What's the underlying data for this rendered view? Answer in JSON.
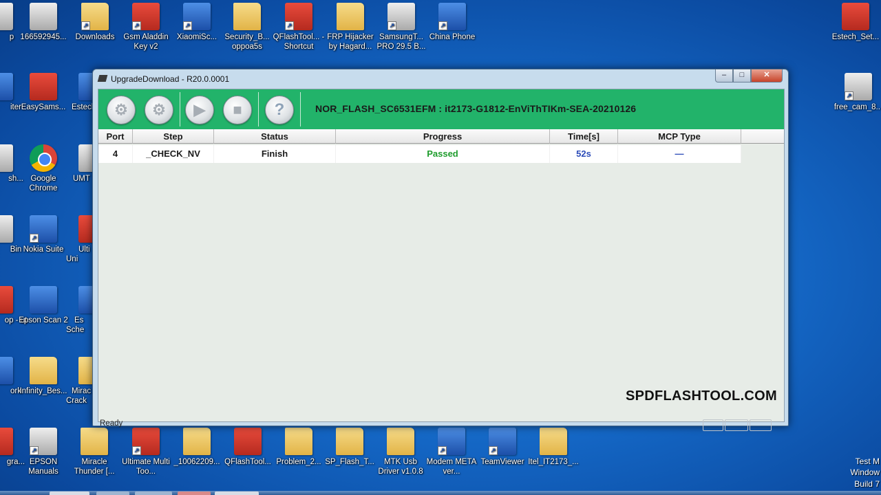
{
  "desktop": {
    "top_icons": [
      {
        "label": "p"
      },
      {
        "label": "166592945..."
      },
      {
        "label": "Downloads"
      },
      {
        "label": "Gsm Aladdin Key v2"
      },
      {
        "label": "XiaomiSc..."
      },
      {
        "label": "Security_B... oppoa5s"
      },
      {
        "label": "QFlashTool... - Shortcut"
      },
      {
        "label": "FRP Hijacker by Hagard..."
      },
      {
        "label": "SamsungT... PRO 29.5 B..."
      },
      {
        "label": "China Phone"
      },
      {
        "label": "Estech_Set..."
      }
    ],
    "left_icons": [
      {
        "label": "iter"
      },
      {
        "label": "EasySams..."
      },
      {
        "label": "Estech"
      },
      {
        "label": "sh..."
      },
      {
        "label": "Google Chrome"
      },
      {
        "label": "UMT"
      },
      {
        "label": "Bin"
      },
      {
        "label": "Nokia Suite"
      },
      {
        "label": "Ulti Uni"
      },
      {
        "label": "op - ut"
      },
      {
        "label": "Epson Scan 2"
      },
      {
        "label": "Es Sche"
      },
      {
        "label": "ork"
      },
      {
        "label": "Infinity_Bes..."
      },
      {
        "label": "Mirac Crack"
      },
      {
        "label": "gra..."
      },
      {
        "label": "EPSON Manuals"
      }
    ],
    "right_icons": [
      {
        "label": "free_cam_8..."
      }
    ],
    "bottom_icons": [
      {
        "label": "Miracle Thunder [..."
      },
      {
        "label": "Ultimate Multi Too..."
      },
      {
        "label": "_10062209..."
      },
      {
        "label": "QFlashTool..."
      },
      {
        "label": "Problem_2..."
      },
      {
        "label": "SP_Flash_T..."
      },
      {
        "label": "MTK Usb Driver v1.0.8"
      },
      {
        "label": "Modem META ver..."
      },
      {
        "label": "TeamViewer"
      },
      {
        "label": "Itel_IT2173_..."
      }
    ],
    "watermark_lines": [
      "Test M",
      "Window",
      "Build 7"
    ]
  },
  "window": {
    "title": "UpgradeDownload  -  R20.0.0001",
    "controls": {
      "minimize": "–",
      "maximize": "□",
      "close": "✕"
    },
    "toolbar": {
      "buttons": [
        {
          "icon": "gear-icon",
          "glyph": "⚙"
        },
        {
          "icon": "settings-gears-icon",
          "glyph": "⚙"
        },
        {
          "icon": "play-icon",
          "glyph": "▶"
        },
        {
          "icon": "stop-icon",
          "glyph": "■"
        },
        {
          "icon": "help-icon",
          "glyph": "?"
        }
      ],
      "firmware_label": "NOR_FLASH_SC6531EFM : it2173-G1812-EnViThTIKm-SEA-20210126"
    },
    "table": {
      "columns": [
        "Port",
        "Step",
        "Status",
        "Progress",
        "Time[s]",
        "MCP Type"
      ],
      "rows": [
        {
          "port": "4",
          "step": "_CHECK_NV",
          "status": "Finish",
          "progress": "Passed",
          "time": "52s",
          "mcp": "—"
        }
      ]
    },
    "overlay_text": "SPDFLASHTOOL.COM",
    "status_text": "Ready"
  },
  "colors": {
    "toolbar_green": "#22b36a",
    "passed_green": "#1e9c2c",
    "time_blue": "#2b4bb8"
  }
}
